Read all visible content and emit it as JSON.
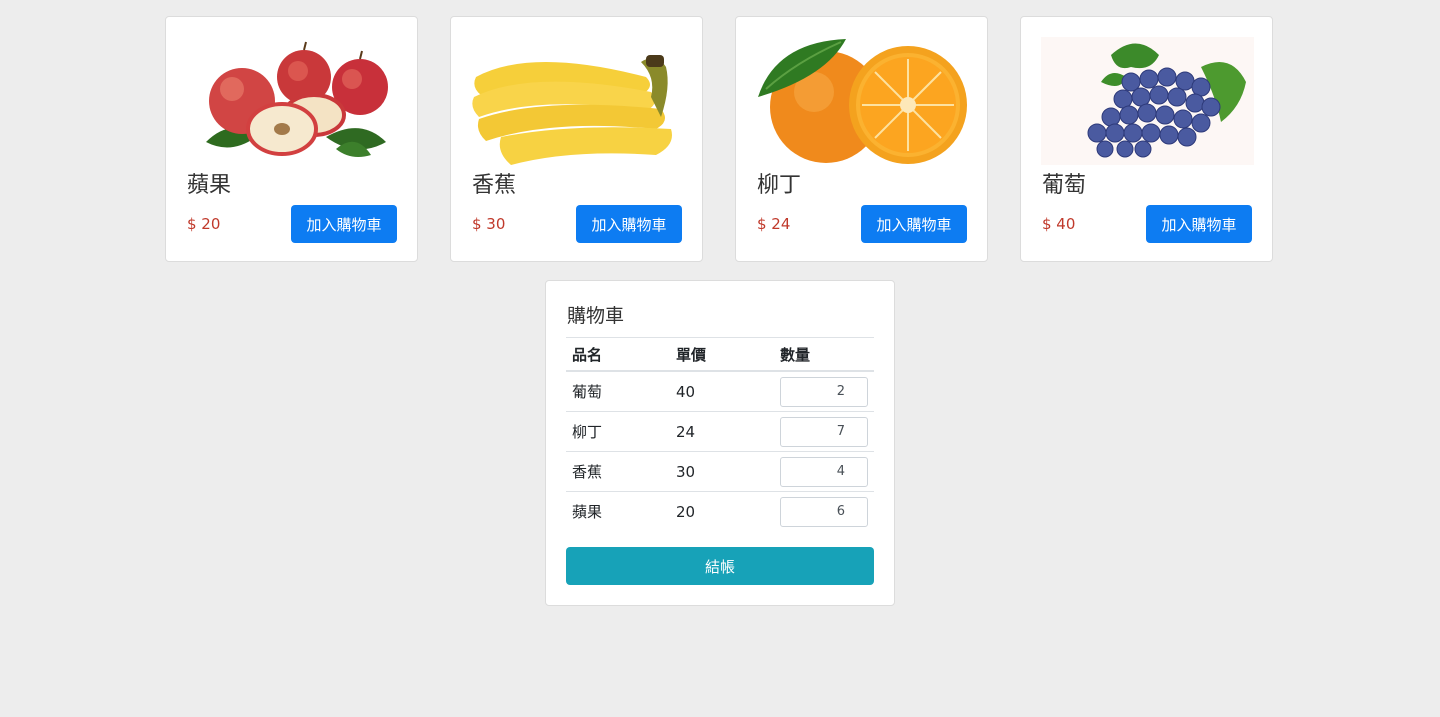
{
  "products": [
    {
      "name": "蘋果",
      "price": "$ 20",
      "button": "加入購物車",
      "image": "apple-image"
    },
    {
      "name": "香蕉",
      "price": "$ 30",
      "button": "加入購物車",
      "image": "banana-image"
    },
    {
      "name": "柳丁",
      "price": "$ 24",
      "button": "加入購物車",
      "image": "orange-image"
    },
    {
      "name": "葡萄",
      "price": "$ 40",
      "button": "加入購物車",
      "image": "grape-image"
    }
  ],
  "cart": {
    "title": "購物車",
    "columns": [
      "品名",
      "單價",
      "數量"
    ],
    "rows": [
      {
        "name": "葡萄",
        "price": "40",
        "qty": "2"
      },
      {
        "name": "柳丁",
        "price": "24",
        "qty": "7"
      },
      {
        "name": "香蕉",
        "price": "30",
        "qty": "4"
      },
      {
        "name": "蘋果",
        "price": "20",
        "qty": "6"
      }
    ],
    "checkout": "結帳"
  },
  "colors": {
    "background": "#ededed",
    "primary_button": "#0d7cf2",
    "checkout_button": "#17a2b8",
    "price_text": "#c0392b"
  }
}
